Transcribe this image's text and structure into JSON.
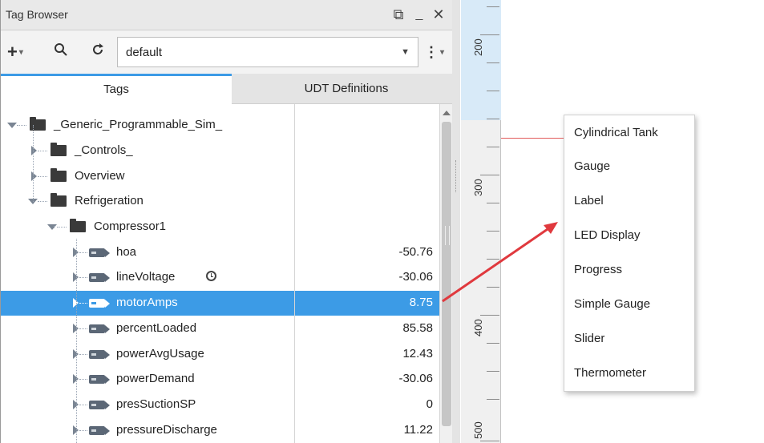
{
  "panel": {
    "title": "Tag Browser",
    "window_controls": [
      "restore-icon",
      "minimize-icon",
      "close-icon"
    ]
  },
  "toolbar": {
    "add_icon": "plus-icon",
    "search_icon": "search-icon",
    "refresh_icon": "refresh-icon",
    "provider_value": "default",
    "more_icon": "vertical-dots-icon"
  },
  "tabs": [
    {
      "label": "Tags",
      "active": true
    },
    {
      "label": "UDT Definitions",
      "active": false
    }
  ],
  "tree": [
    {
      "label": "_Generic_Programmable_Sim_",
      "value": "",
      "type": "folder",
      "expanded": true
    },
    {
      "label": "_Controls_",
      "value": "",
      "type": "folder",
      "expanded": false
    },
    {
      "label": "Overview",
      "value": "",
      "type": "folder",
      "expanded": false
    },
    {
      "label": "Refrigeration",
      "value": "",
      "type": "folder",
      "expanded": true
    },
    {
      "label": "Compressor1",
      "value": "",
      "type": "folder",
      "expanded": true
    },
    {
      "label": "hoa",
      "value": "-50.76",
      "type": "tag"
    },
    {
      "label": "lineVoltage",
      "value": "-30.06",
      "type": "tag",
      "history": true
    },
    {
      "label": "motorAmps",
      "value": "8.75",
      "type": "tag",
      "selected": true
    },
    {
      "label": "percentLoaded",
      "value": "85.58",
      "type": "tag"
    },
    {
      "label": "powerAvgUsage",
      "value": "12.43",
      "type": "tag"
    },
    {
      "label": "powerDemand",
      "value": "-30.06",
      "type": "tag"
    },
    {
      "label": "presSuctionSP",
      "value": "0",
      "type": "tag"
    },
    {
      "label": "pressureDischarge",
      "value": "11.22",
      "type": "tag"
    }
  ],
  "ruler": {
    "labels": [
      "200",
      "300",
      "400",
      "500"
    ]
  },
  "menu": {
    "items": [
      "Cylindrical Tank",
      "Gauge",
      "Label",
      "LED Display",
      "Progress",
      "Simple Gauge",
      "Slider",
      "Thermometer"
    ]
  },
  "colors": {
    "selection": "#3c9be6",
    "arrow": "#e0393e"
  }
}
